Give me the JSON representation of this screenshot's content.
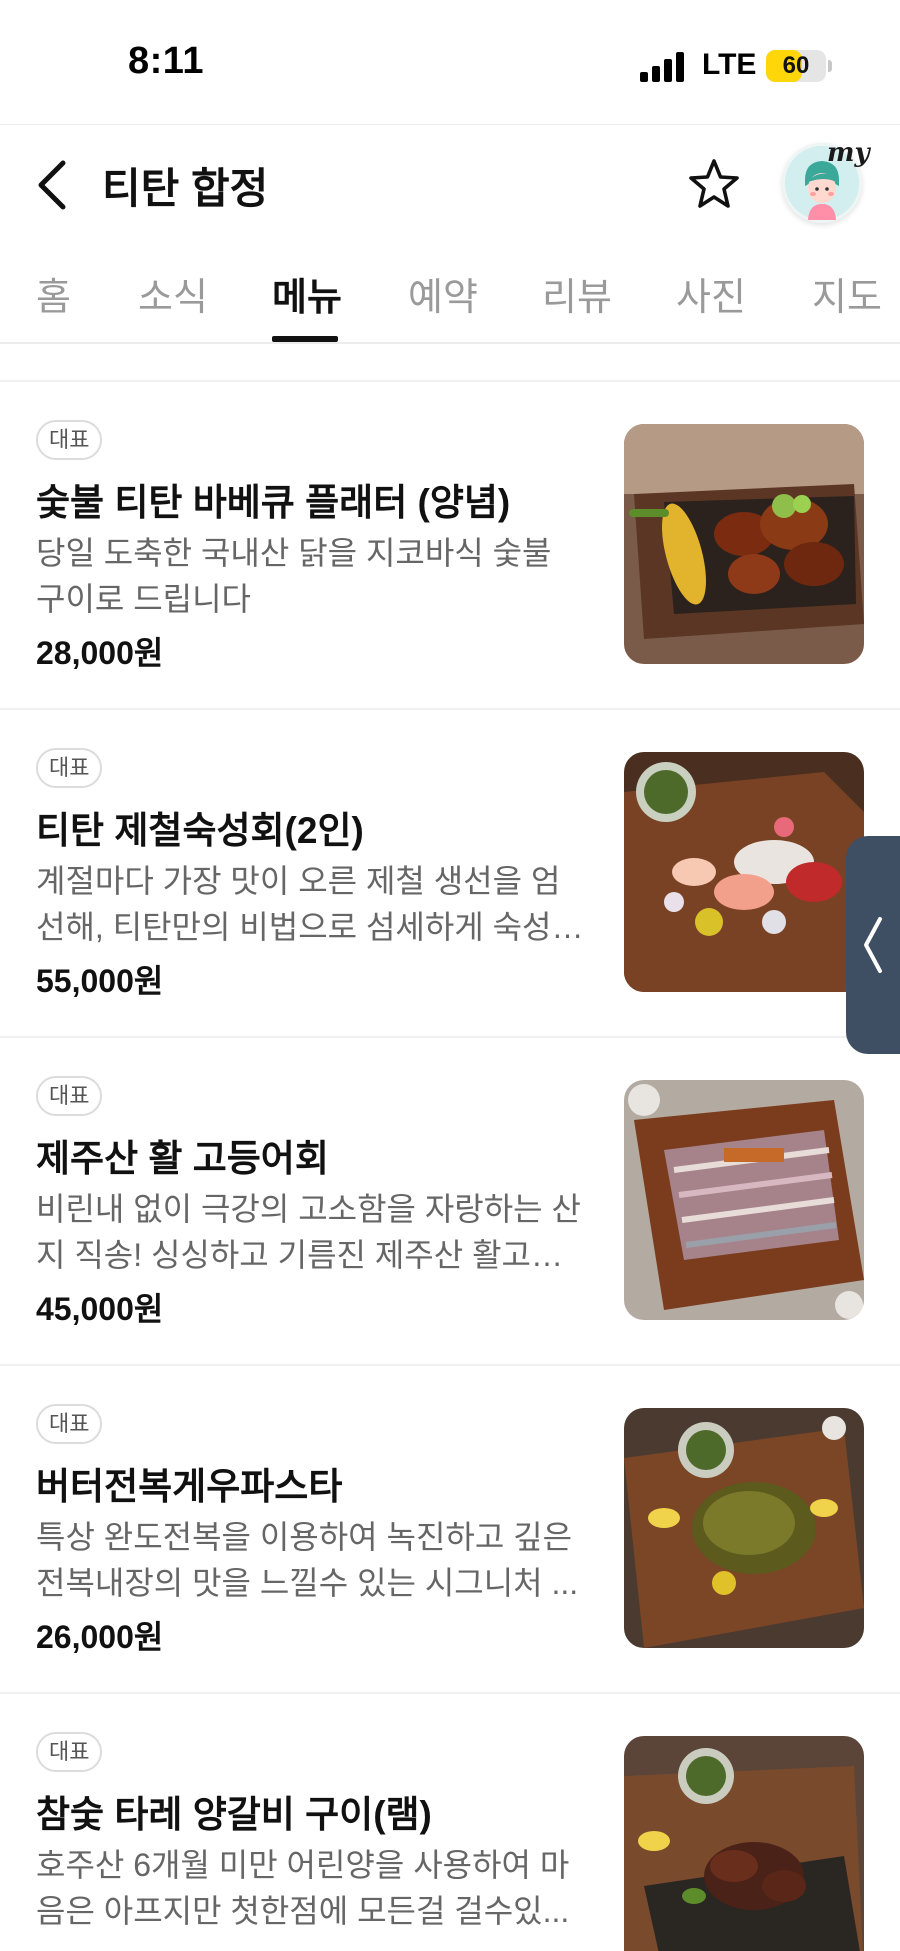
{
  "status_bar": {
    "time": "8:11",
    "network": "LTE",
    "battery": "60",
    "battery_level": 0.6
  },
  "header": {
    "title": "티탄 합정",
    "my_label": "my"
  },
  "tabs": [
    {
      "label": "홈"
    },
    {
      "label": "소식"
    },
    {
      "label": "메뉴"
    },
    {
      "label": "예약"
    },
    {
      "label": "리뷰"
    },
    {
      "label": "사진"
    },
    {
      "label": "지도"
    }
  ],
  "active_tab": "메뉴",
  "menu_items": [
    {
      "badge": "대표",
      "name": "숯불 티탄 바베큐 플래터 (양념)",
      "description": "당일 도축한 국내산 닭을 지코바식 숯불 구이로 드립니다",
      "price": "28,000원"
    },
    {
      "badge": "대표",
      "name": "티탄 제철숙성회(2인)",
      "description": "계절마다 가장 맛이 오른 제철 생선을 엄선해, 티탄만의 비법으로 섬세하게 숙성했...",
      "price": "55,000원"
    },
    {
      "badge": "대표",
      "name": "제주산 활 고등어회",
      "description": "비린내 없이 극강의 고소함을 자랑하는 산지 직송! 싱싱하고 기름진 제주산 활고등...",
      "price": "45,000원"
    },
    {
      "badge": "대표",
      "name": "버터전복게우파스타",
      "description": "특상 완도전복을 이용하여 녹진하고 깊은 전복내장의 맛을 느낄수 있는 시그니처 ...",
      "price": "26,000원"
    },
    {
      "badge": "대표",
      "name": "참숯 타레 양갈비 구이(램)",
      "description": "호주산 6개월 미만 어린양을 사용하여 마음은 아프지만 첫한점에 모든걸 걸수있...",
      "price": ""
    }
  ],
  "colors": {
    "accent": "#111111",
    "battery": "#ffd60a",
    "handle": "#3e4e63",
    "badge_border": "#dcdcdc"
  }
}
